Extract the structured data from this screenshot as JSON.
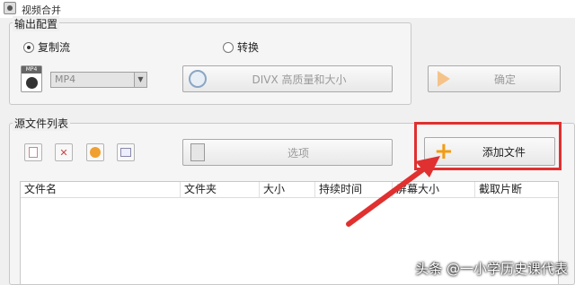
{
  "window": {
    "title": "视频合并"
  },
  "output_config": {
    "title": "输出配置",
    "radio_copy": "复制流",
    "radio_convert": "转换",
    "format": "MP4",
    "profile_button": "DIVX 高质量和大小",
    "ok_button": "确定"
  },
  "source_list": {
    "title": "源文件列表",
    "options_button": "选项",
    "add_file_button": "添加文件",
    "columns": [
      "文件名",
      "文件夹",
      "大小",
      "持续时间",
      "屏幕大小",
      "截取片断"
    ]
  },
  "watermark": "头条 @一小学历史课代表",
  "colors": {
    "highlight": "#e03030",
    "add_icon": "#f39c12"
  }
}
